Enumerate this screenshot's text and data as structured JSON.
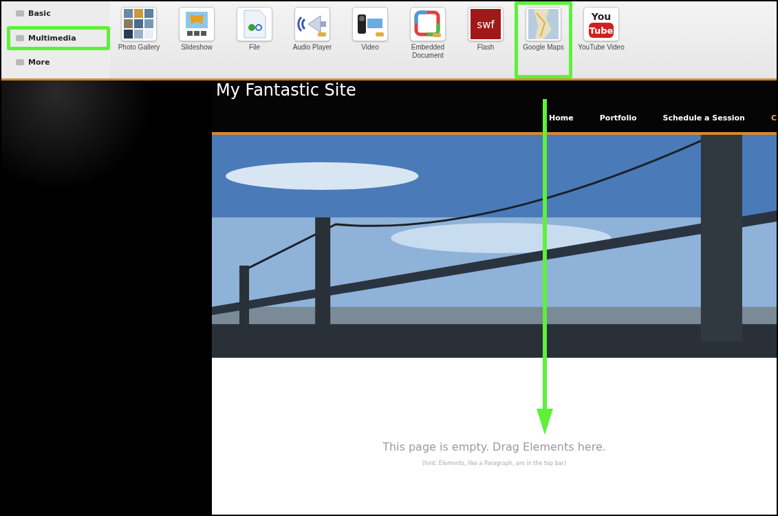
{
  "categories": [
    {
      "label": "Basic",
      "highlighted": false
    },
    {
      "label": "Multimedia",
      "highlighted": true
    },
    {
      "label": "More",
      "highlighted": false
    }
  ],
  "elements": [
    {
      "kind": "gallery",
      "label": "Photo Gallery",
      "highlighted": false
    },
    {
      "kind": "slideshow",
      "label": "Slideshow",
      "highlighted": false
    },
    {
      "kind": "file",
      "label": "File",
      "highlighted": false
    },
    {
      "kind": "audio",
      "label": "Audio Player",
      "highlighted": false
    },
    {
      "kind": "video",
      "label": "Video",
      "highlighted": false
    },
    {
      "kind": "document",
      "label": "Embedded Document",
      "highlighted": false
    },
    {
      "kind": "flash",
      "label": "Flash",
      "icon_text": "swf",
      "highlighted": false
    },
    {
      "kind": "map",
      "label": "Google Maps",
      "highlighted": true
    },
    {
      "kind": "youtube",
      "label": "YouTube Video",
      "icon_text": [
        "You",
        "Tube"
      ],
      "highlighted": false
    }
  ],
  "site": {
    "title": "My Fantastic Site",
    "nav": [
      {
        "label": "Home",
        "selected": false
      },
      {
        "label": "Portfolio",
        "selected": false
      },
      {
        "label": "Schedule a Session",
        "selected": false
      },
      {
        "label": "C",
        "selected": true
      }
    ]
  },
  "empty_message": "This page is empty. Drag Elements here.",
  "hint": "(hint: Elements, like a Paragraph, are in the top bar)"
}
